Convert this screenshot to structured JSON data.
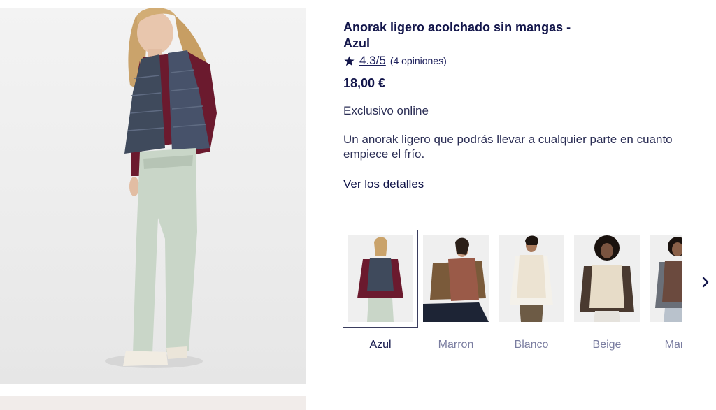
{
  "product": {
    "title": "Anorak ligero acolchado sin mangas - Azul",
    "rating": "4.3/5",
    "reviews": "(4 opiniones)",
    "price": "18,00 €",
    "exclusive": "Exclusivo online",
    "description": "Un anorak ligero que podrás llevar a cualquier parte en cuanto empiece el frío.",
    "details_link": "Ver los detalles"
  },
  "colors": {
    "selected": "Azul",
    "options": [
      {
        "label": "Azul",
        "vest": "#3f4a5c",
        "sweater": "#6b1a2e",
        "pants": "#c9d6c8"
      },
      {
        "label": "Marron",
        "vest": "#9a5a48",
        "sweater": "#7a5a3a",
        "pants": "#1d2435"
      },
      {
        "label": "Blanco",
        "vest": "#ece3d2",
        "sweater": "#f4f1ea",
        "pants": "#6d5b45"
      },
      {
        "label": "Beige",
        "vest": "#e7dcc8",
        "sweater": "#4a3a30",
        "pants": "#e5e2dc"
      },
      {
        "label": "Marron",
        "vest": "#6b4a3e",
        "sweater": "#6a6f78",
        "pants": "#b9c2cc"
      }
    ]
  },
  "icons": {
    "star": "star-icon",
    "next": "chevron-right-icon"
  }
}
